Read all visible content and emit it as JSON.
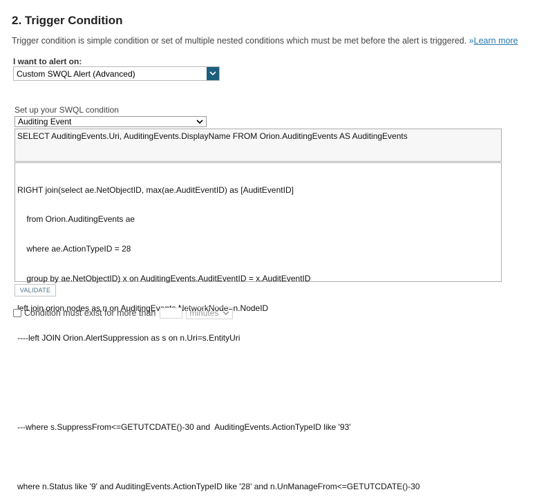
{
  "section": {
    "title": "2. Trigger Condition",
    "description": "Trigger condition is simple condition or set of multiple nested conditions which must be met before the alert is triggered. ",
    "learn_more_prefix": "»",
    "learn_more_label": "Learn more"
  },
  "alert_on": {
    "label": "I want to alert on:",
    "selected": "Custom SWQL Alert (Advanced)"
  },
  "swql": {
    "label": "Set up your SWQL condition",
    "entity_selected": "Auditing Event",
    "select_statement": "SELECT AuditingEvents.Uri, AuditingEvents.DisplayName FROM Orion.AuditingEvents AS AuditingEvents",
    "query_lines": [
      "RIGHT join(select ae.NetObjectID, max(ae.AuditEventID) as [AuditEventID]",
      "    from Orion.AuditingEvents ae",
      "    where ae.ActionTypeID = 28",
      "    group by ae.NetObjectID) x on AuditingEvents.AuditEventID = x.AuditEventID",
      "left join orion.nodes as n on AuditingEvents.NetworkNode=n.NodeID",
      "----left JOIN Orion.AlertSuppression as s on n.Uri=s.EntityUri",
      "",
      "",
      "---where s.SuppressFrom<=GETUTCDATE()-30 and  AuditingEvents.ActionTypeID like '93'",
      "",
      "where n.Status like '9' and AuditingEvents.ActionTypeID like '28' and n.UnManageFrom<=GETUTCDATE()-30"
    ],
    "validate_label": "VALIDATE"
  },
  "condition": {
    "label": "Condition must exist for more than",
    "duration_value": "",
    "unit_selected": "minutes"
  }
}
